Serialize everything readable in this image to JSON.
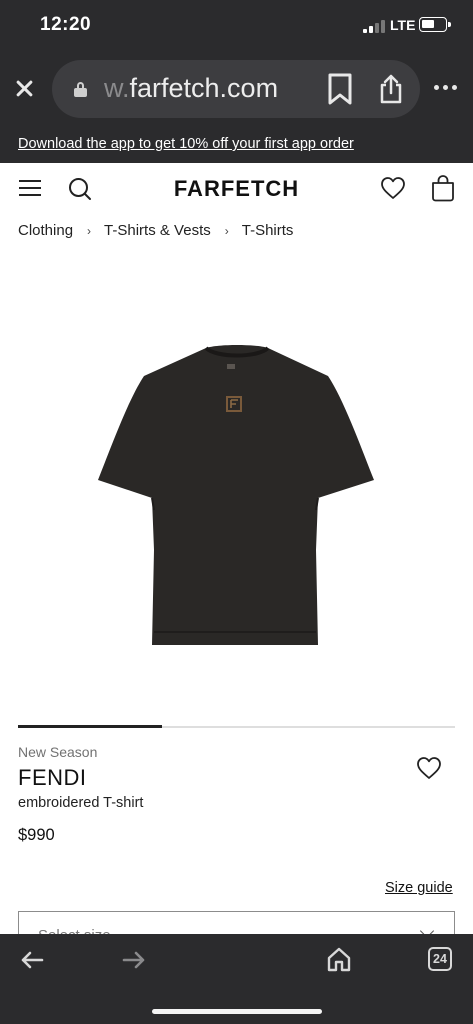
{
  "status_bar": {
    "time": "12:20",
    "network": "LTE",
    "icons": [
      "signal-icon",
      "battery-icon"
    ]
  },
  "browser": {
    "url_prefix": "w.",
    "url_domain": "farfetch.com",
    "icons": [
      "close-icon",
      "lock-icon",
      "bookmark-icon",
      "share-icon",
      "more-icon"
    ]
  },
  "promo_banner": {
    "text": "Download the app to get 10% off your first app order"
  },
  "header": {
    "logo": "FARFETCH",
    "icons": [
      "menu-icon",
      "search-icon",
      "heart-icon",
      "bag-icon"
    ]
  },
  "breadcrumb": [
    "Clothing",
    "T-Shirts & Vests",
    "T-Shirts"
  ],
  "gallery": {
    "image_subject": "black t-shirt with FF logo",
    "progress_fraction": 0.33
  },
  "product": {
    "tag": "New Season",
    "brand": "FENDI",
    "name": "embroidered T-shirt",
    "price": "$990",
    "size_guide_label": "Size guide",
    "size_placeholder": "Select size"
  },
  "toolbar": {
    "tab_count": "24",
    "icons": [
      "back-arrow-icon",
      "forward-arrow-icon",
      "home-icon",
      "tabs-icon"
    ]
  },
  "colors": {
    "chrome": "#2b2b2d",
    "url_pill": "#3d3d40",
    "page": "#ffffff",
    "text": "#111111",
    "muted": "#727272",
    "shirt": "#2a2826",
    "logo_embroidery": "#7a5a3a"
  }
}
